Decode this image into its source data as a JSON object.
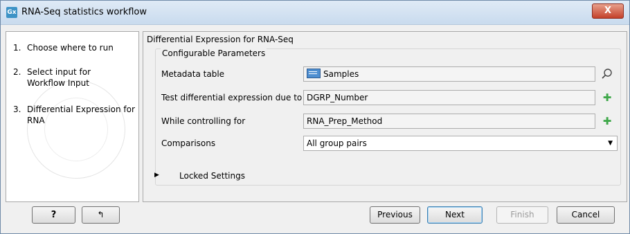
{
  "window": {
    "title": "RNA-Seq statistics workflow",
    "icon_text": "Gx",
    "close_label": "X"
  },
  "steps": [
    {
      "num": "1.",
      "label": "Choose where to run"
    },
    {
      "num": "2.",
      "label": "Select input for Workflow Input"
    },
    {
      "num": "3.",
      "label": "Differential Expression for RNA"
    }
  ],
  "panel": {
    "title": "Differential Expression for RNA-Seq",
    "group_title": "Configurable Parameters",
    "rows": {
      "metadata": {
        "label": "Metadata table",
        "value": "Samples"
      },
      "test": {
        "label": "Test differential expression due to",
        "value": "DGRP_Number"
      },
      "control": {
        "label": "While controlling for",
        "value": "RNA_Prep_Method"
      },
      "comparisons": {
        "label": "Comparisons",
        "value": "All group pairs"
      }
    },
    "locked_label": "Locked Settings"
  },
  "footer": {
    "help_label": "?",
    "reset_icon": "↰",
    "previous_label": "Previous",
    "next_label": "Next",
    "finish_label": "Finish",
    "cancel_label": "Cancel"
  }
}
